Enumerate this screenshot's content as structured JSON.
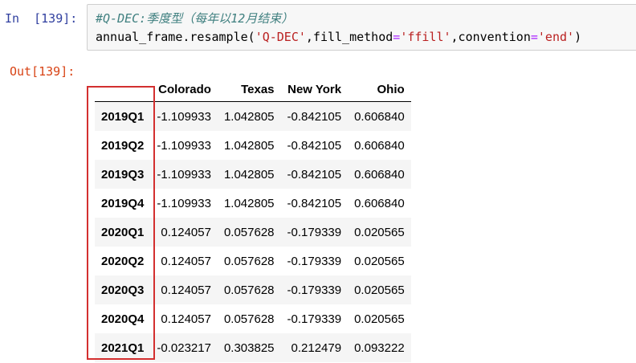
{
  "input_cell": {
    "prompt": "In  [139]:",
    "comment": "#Q-DEC:季度型（每年以12月结束）",
    "code": {
      "func": "annual_frame.resample(",
      "arg1": "'Q-DEC'",
      "sep1": ",fill_method",
      "eq1": "=",
      "arg2": "'ffill'",
      "sep2": ",convention",
      "eq2": "=",
      "arg3": "'end'",
      "close": ")"
    }
  },
  "output_cell": {
    "prompt": "Out[139]:"
  },
  "table": {
    "columns": [
      "Colorado",
      "Texas",
      "New York",
      "Ohio"
    ],
    "rows": [
      {
        "index": "2019Q1",
        "values": [
          "-1.109933",
          "1.042805",
          "-0.842105",
          "0.606840"
        ]
      },
      {
        "index": "2019Q2",
        "values": [
          "-1.109933",
          "1.042805",
          "-0.842105",
          "0.606840"
        ]
      },
      {
        "index": "2019Q3",
        "values": [
          "-1.109933",
          "1.042805",
          "-0.842105",
          "0.606840"
        ]
      },
      {
        "index": "2019Q4",
        "values": [
          "-1.109933",
          "1.042805",
          "-0.842105",
          "0.606840"
        ]
      },
      {
        "index": "2020Q1",
        "values": [
          "0.124057",
          "0.057628",
          "-0.179339",
          "0.020565"
        ]
      },
      {
        "index": "2020Q2",
        "values": [
          "0.124057",
          "0.057628",
          "-0.179339",
          "0.020565"
        ]
      },
      {
        "index": "2020Q3",
        "values": [
          "0.124057",
          "0.057628",
          "-0.179339",
          "0.020565"
        ]
      },
      {
        "index": "2020Q4",
        "values": [
          "0.124057",
          "0.057628",
          "-0.179339",
          "0.020565"
        ]
      },
      {
        "index": "2021Q1",
        "values": [
          "-0.023217",
          "0.303825",
          "0.212479",
          "0.093222"
        ]
      }
    ]
  },
  "colors": {
    "highlight_box": "#d32f2f",
    "in_prompt": "#303f9f",
    "out_prompt": "#d84315"
  }
}
